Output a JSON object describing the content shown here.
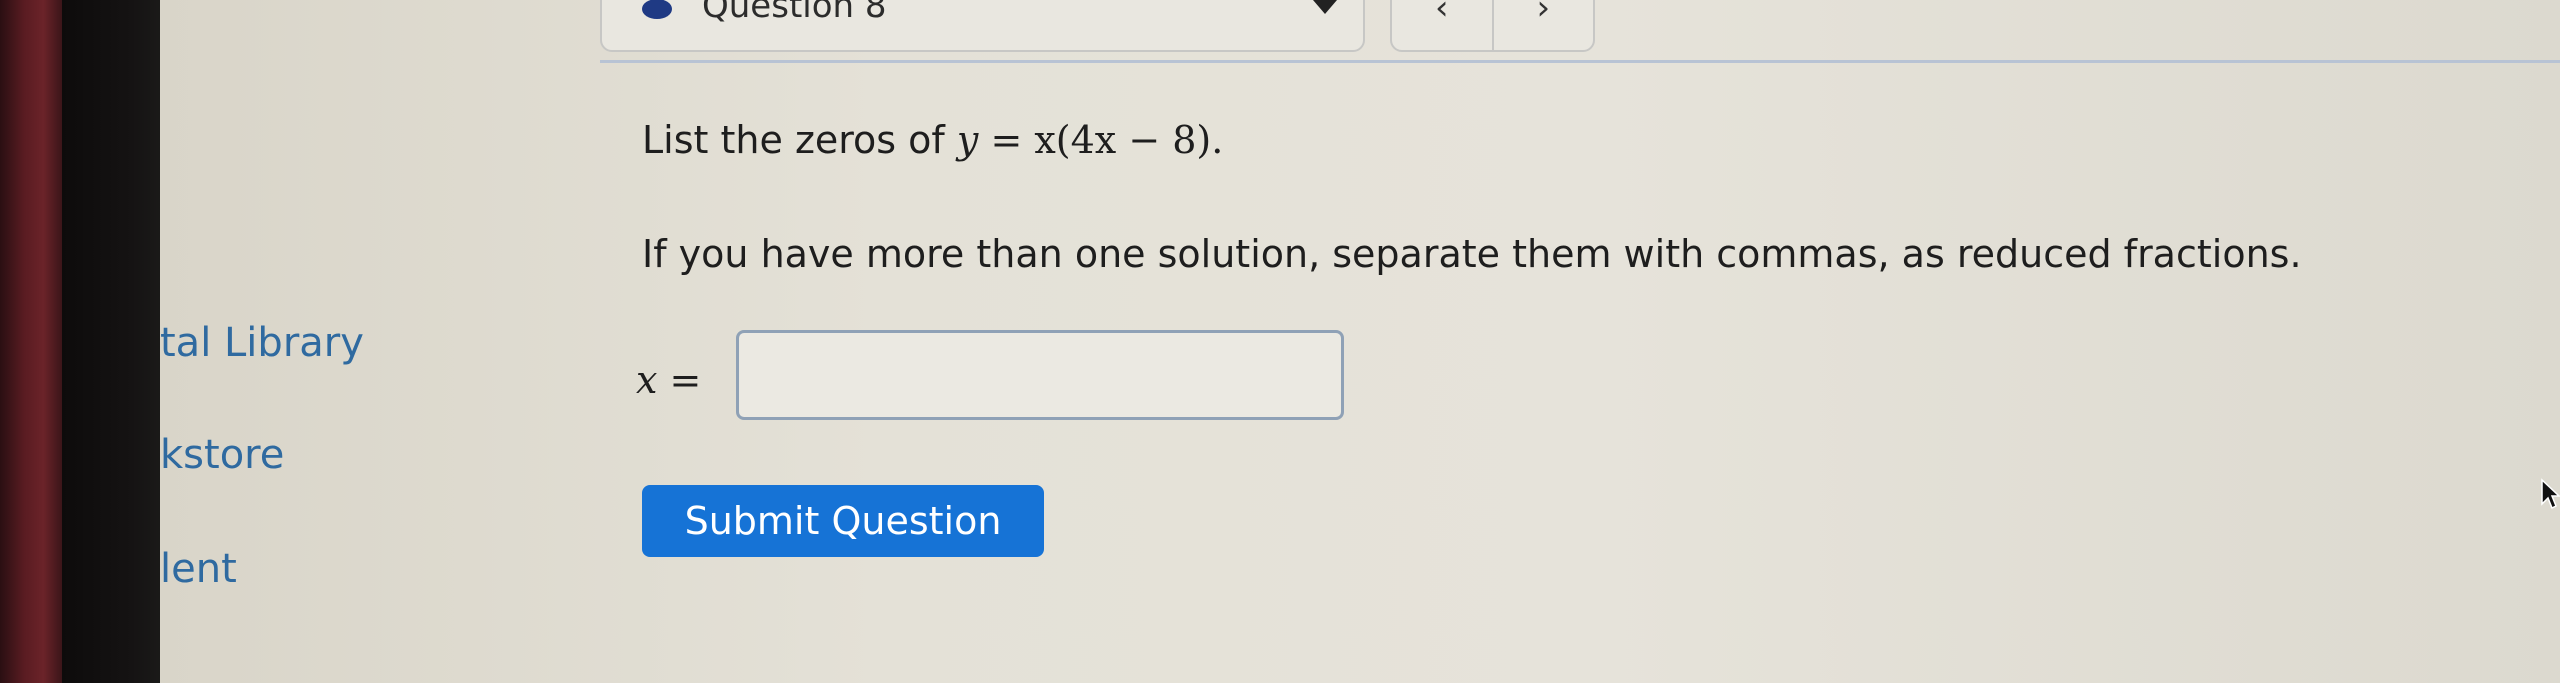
{
  "header": {
    "question_label": "Question 8",
    "prev_icon": "chevron-left-icon",
    "next_icon": "chevron-right-icon"
  },
  "sidebar": {
    "items": [
      {
        "label": "tal Library"
      },
      {
        "label": "kstore"
      },
      {
        "label": "lent"
      }
    ]
  },
  "question": {
    "prompt_text": "List the zeros of",
    "equation_lhs": "y",
    "equation_eq": " = ",
    "equation_rhs": "x(4x − 8).",
    "instruction": "If you have more than one solution, separate them with commas, as reduced fractions.",
    "answer_label_var": "x",
    "answer_label_eq": " =",
    "answer_value": "",
    "submit_label": "Submit Question"
  },
  "colors": {
    "accent": "#1673d6",
    "link": "#2f6aa0"
  }
}
